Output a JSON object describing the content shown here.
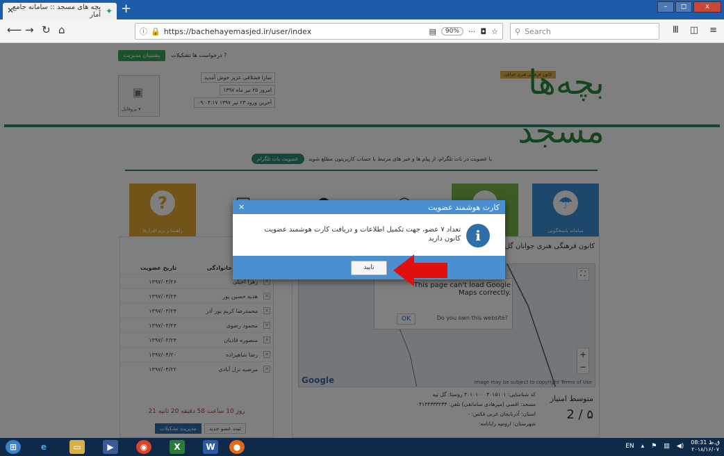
{
  "browser": {
    "tab_title": "بچه های مسجد :: سامانه جامع آمار",
    "tab_close": "✕",
    "new_tab": "+",
    "url": "https://bachehayemasjed.ir/user/index",
    "zoom": "90%",
    "search_placeholder": "Search",
    "window_controls": [
      "–",
      "◻",
      "x"
    ]
  },
  "header": {
    "logo_text": "بچه‌ها مسجد",
    "logo_subtitle": "کانون فرهنگی هنری جوانان",
    "support_button": "پشتیبان مدیریت",
    "top_links": "? درخواست ها   تشکیلات",
    "profile_label": "پروفایل ▾",
    "info_lines": [
      "سارا فشلاقی عزیز خوش آمدید",
      "امروز ۲۵ تیر ماه ۱۳۹۷",
      "آخرین ورود ۲۳ تیر ۱۳۹۷ ۰۹:۰۴:۱۷"
    ]
  },
  "telegram": {
    "text": "با عضویت در بات تلگرام، از پیام ها و خبر های مرتبط با حساب کاربریتون مطلع شوید",
    "button": "عضویت بات تلگرام"
  },
  "tiles": [
    {
      "label": "راهنما و نرم افزارها",
      "color": "#e4a832",
      "icon": "?"
    },
    {
      "label": "",
      "color": "#ffffff",
      "icon": "▤"
    },
    {
      "label": "",
      "color": "#ffffff",
      "icon": "●"
    },
    {
      "label": "",
      "color": "#ffffff",
      "icon": "◉"
    },
    {
      "label": "",
      "color": "#7bb84a",
      "icon": "➦"
    },
    {
      "label": "سامانه پاسخگویی",
      "color": "#3a8fd6",
      "icon": "☂"
    }
  ],
  "members": {
    "headers": [
      "نام و نام خانوادگی",
      "تاریخ عضویت"
    ],
    "rows": [
      [
        "زهرا آجیلی",
        "۱۳۹۷/۰۳/۲۶"
      ],
      [
        "هدیه حسین پور",
        "۱۳۹۷/۰۳/۲۴"
      ],
      [
        "محمدرضا کریم پور آذر",
        "۱۳۹۷/۰۳/۲۴"
      ],
      [
        "محمود رضوی",
        "۱۳۹۷/۰۳/۲۴"
      ],
      [
        "منصوره قادیان",
        "۱۳۹۷/۰۳/۲۴"
      ],
      [
        "رضا شاهپزاده",
        "۱۳۹۷/۰۴/۲۰"
      ],
      [
        "مرضیه نزل آبادی",
        "۱۳۹۷/۰۴/۲۲"
      ]
    ],
    "timer": "21 روز 10 ساعت 58 دقیقه 20 ثانیه",
    "new_member_button": "ثبت عضو جدید",
    "manage_button": "مدیریت تشکیلات"
  },
  "center": {
    "title": "کانون فرهنگی هنری جوانان گل تپه",
    "map_error": "This page can't load Google Maps correctly.",
    "map_ok": "OK",
    "map_own": "Do you own this website?",
    "google": "Google",
    "map_footer": "Image may be subject to copyright   Terms of Use",
    "details": [
      "کد شناسایی: ۴۰۱۰۱۰۰۰۴۰۱۵۱۰۱   روستا: گل تپه",
      "مسجد: اقصی (میرهادی سامانقی)   تلفن: ۰۴۱۴۴۳۳۳۲۳۳",
      "استان: آذربایجان غربی   فکس: -",
      "شهرستان: ارومیه   رایانامه:"
    ],
    "rating_title": "متوسط امتیاز",
    "rating_value": "۵ / 2"
  },
  "modal": {
    "title": "کارت هوشمند عضویت",
    "close": "×",
    "message": "تعداد ۷ عضو، جهت تکمیل اطلاعات و دریافت کارت هوشمند عضویت کانون دارید",
    "confirm": "تایید"
  },
  "taskbar": {
    "lang": "EN",
    "time": "08:31 ق.ظ",
    "date": "۲۰۱۸/۱۶/۰۷"
  }
}
